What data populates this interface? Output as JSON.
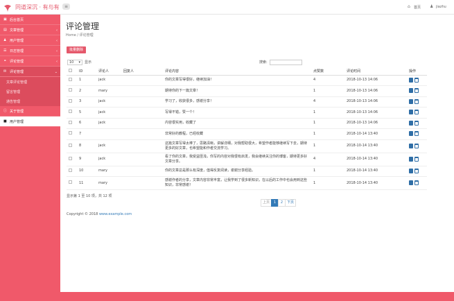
{
  "app": {
    "logo_text": "同道深沉 · 有与有",
    "brand_color": "#f0596a",
    "menu_toggle_icon": "menu-icon"
  },
  "topbar": {
    "home_label": "首页",
    "user_label": "jiazhu",
    "home_icon": "home-icon",
    "user_icon": "user-icon"
  },
  "sidebar": {
    "items": [
      {
        "label": "后台首页",
        "icon": "dashboard-icon"
      },
      {
        "label": "文章管理",
        "icon": "file-icon"
      },
      {
        "label": "用户管理",
        "icon": "user-icon"
      },
      {
        "label": "日志管理",
        "icon": "list-icon"
      },
      {
        "label": "评论管理",
        "icon": "comment-icon"
      }
    ],
    "sub_items": [
      "文章评论管理",
      "留言管理",
      "通告管理"
    ],
    "extra_items": [
      {
        "label": "关于管理",
        "icon": "info-icon"
      },
      {
        "label": "用户管理",
        "icon": "user-icon"
      }
    ]
  },
  "main": {
    "title": "评论管理",
    "breadcrumb": "Home / 评论管理",
    "batch_delete": "批量删除",
    "length_value": "10",
    "length_label": "显示",
    "search_label": "搜索:",
    "search_value": ""
  },
  "table": {
    "headers": [
      "",
      "ID",
      "评论人",
      "回复人",
      "评论内容",
      "点赞数",
      "评论时间",
      "操作"
    ],
    "rows": [
      {
        "id": "1",
        "user": "jack",
        "reply": "",
        "content": "你的文章写得很好，继续加油！",
        "likes": "4",
        "time": "2018-10-13 14:06"
      },
      {
        "id": "2",
        "user": "mary",
        "reply": "",
        "content": "期待你的下一篇文章！",
        "likes": "1",
        "time": "2018-10-13 14:06"
      },
      {
        "id": "3",
        "user": "jack",
        "reply": "",
        "content": "学习了，收获很多，感谢分享！",
        "likes": "4",
        "time": "2018-10-13 14:06"
      },
      {
        "id": "5",
        "user": "jack",
        "reply": "",
        "content": "写得不错，赞一个！",
        "likes": "1",
        "time": "2018-10-13 14:06"
      },
      {
        "id": "6",
        "user": "jack",
        "reply": "",
        "content": "内容很实用，收藏了",
        "likes": "1",
        "time": "2018-10-13 14:06"
      },
      {
        "id": "7",
        "user": "",
        "reply": "",
        "content": "非常好的教程，已经收藏",
        "likes": "1",
        "time": "2018-10-14 13:40"
      },
      {
        "id": "8",
        "user": "jack",
        "reply": "",
        "content": "这篇文章写得太棒了，思路清晰，讲解详细，对我帮助很大，希望作者能够继续写下去，期待更多的好文章，也希望能和作者交流学习。",
        "likes": "1",
        "time": "2018-10-14 13:40"
      },
      {
        "id": "9",
        "user": "jack",
        "reply": "",
        "content": "看了你的文章，我受益匪浅，你写的内容对我很有启发，我会继续关注你的博客，期待更多好文章分享。",
        "likes": "4",
        "time": "2018-10-14 13:40"
      },
      {
        "id": "10",
        "user": "mary",
        "reply": "",
        "content": "你的文章总是那么有深度，值得反复阅读，谢谢分享经验。",
        "likes": "1",
        "time": "2018-10-14 13:40"
      },
      {
        "id": "11",
        "user": "mary",
        "reply": "",
        "content": "感谢作者的分享，文章内容非常丰富，让我学到了很多新知识，在以后的工作中也会用到这些知识，非常感谢！",
        "likes": "1",
        "time": "2018-10-14 13:40"
      }
    ]
  },
  "footer_info": "显示第 1 至 10 项，共 12 项",
  "pagination": {
    "prev": "上页",
    "pages": [
      "1",
      "2"
    ],
    "next": "下页",
    "active": "1"
  },
  "copyright": {
    "text": "Copyright © 2018 ",
    "link": "www.example.com"
  }
}
